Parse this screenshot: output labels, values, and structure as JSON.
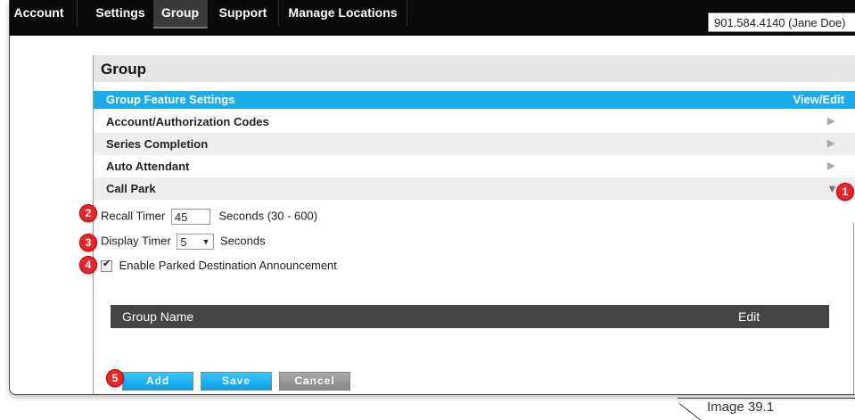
{
  "nav": {
    "tabs": [
      {
        "label": "Account"
      },
      {
        "label": "Settings"
      },
      {
        "label": "Group"
      },
      {
        "label": "Support"
      },
      {
        "label": "Manage Locations"
      }
    ],
    "user": "901.584.4140 (Jane Doe)"
  },
  "group": {
    "title": "Group",
    "feature_bar": {
      "label": "Group Feature Settings",
      "action": "View/Edit"
    },
    "rows": [
      {
        "label": "Account/Authorization Codes"
      },
      {
        "label": "Series Completion"
      },
      {
        "label": "Auto Attendant"
      },
      {
        "label": "Call Park"
      }
    ]
  },
  "call_park": {
    "recall_timer_label": "Recall Timer",
    "recall_timer_value": "45",
    "recall_timer_suffix": "Seconds (30 - 600)",
    "display_timer_label": "Display Timer",
    "display_timer_value": "5",
    "display_timer_suffix": "Seconds",
    "announcement_label": "Enable Parked Destination Announcement",
    "announcement_checked": true
  },
  "table": {
    "col_name": "Group Name",
    "col_edit": "Edit"
  },
  "buttons": {
    "add": "Add",
    "save": "Save",
    "cancel": "Cancel"
  },
  "badges": [
    "1",
    "2",
    "3",
    "4",
    "5"
  ],
  "caption": "Image 39.1",
  "colors": {
    "accent": "#1aaee8",
    "badge": "#e8262a",
    "nav_bg": "#0a0a0a"
  }
}
